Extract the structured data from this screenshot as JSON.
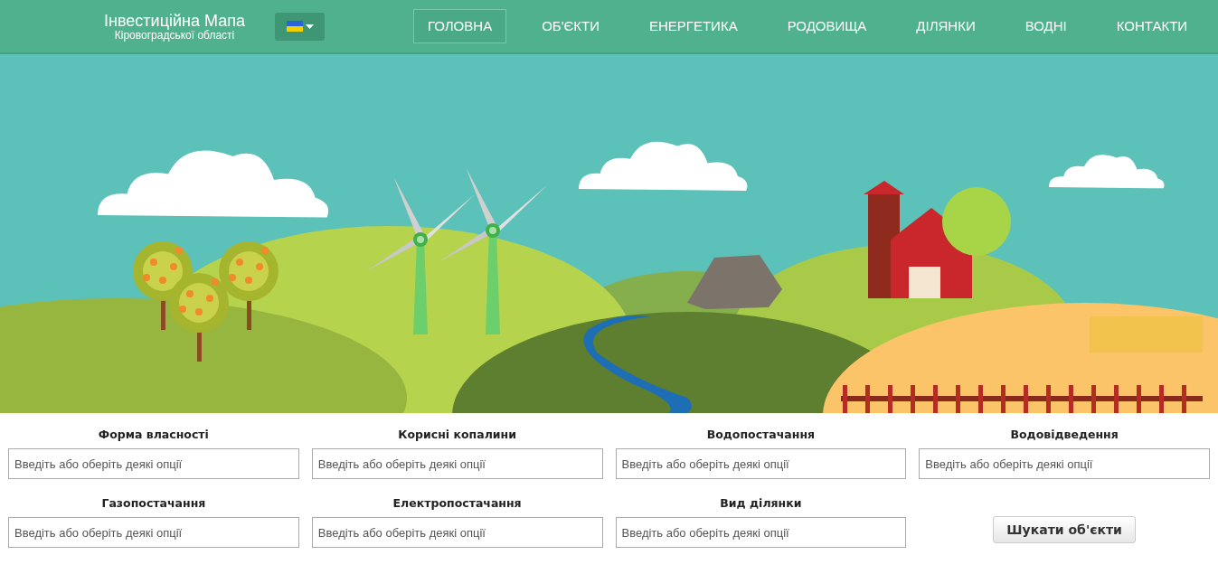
{
  "header": {
    "logo_title": "Інвестиційна Мапа",
    "logo_subtitle": "Кіровоградської області"
  },
  "nav": [
    {
      "label": "ГОЛОВНА",
      "selected": true
    },
    {
      "label": "ОБ'ЄКТИ",
      "selected": false
    },
    {
      "label": "ЕНЕРГЕТИКА",
      "selected": false
    },
    {
      "label": "РОДОВИЩА",
      "selected": false
    },
    {
      "label": "ДІЛЯНКИ",
      "selected": false
    },
    {
      "label": "ВОДНІ",
      "selected": false
    },
    {
      "label": "КОНТАКТИ",
      "selected": false
    }
  ],
  "filters": [
    {
      "label": "Форма власності",
      "placeholder": "Введіть або оберіть деякі опції"
    },
    {
      "label": "Корисні копалини",
      "placeholder": "Введіть або оберіть деякі опції"
    },
    {
      "label": "Водопостачання",
      "placeholder": "Введіть або оберіть деякі опції"
    },
    {
      "label": "Водовідведення",
      "placeholder": "Введіть або оберіть деякі опції"
    },
    {
      "label": "Газопостачання",
      "placeholder": "Введіть або оберіть деякі опції"
    },
    {
      "label": "Електропостачання",
      "placeholder": "Введіть або оберіть деякі опції"
    },
    {
      "label": "Вид ділянки",
      "placeholder": "Введіть або оберіть деякі опції"
    }
  ],
  "search_button": "Шукати об'єкти"
}
